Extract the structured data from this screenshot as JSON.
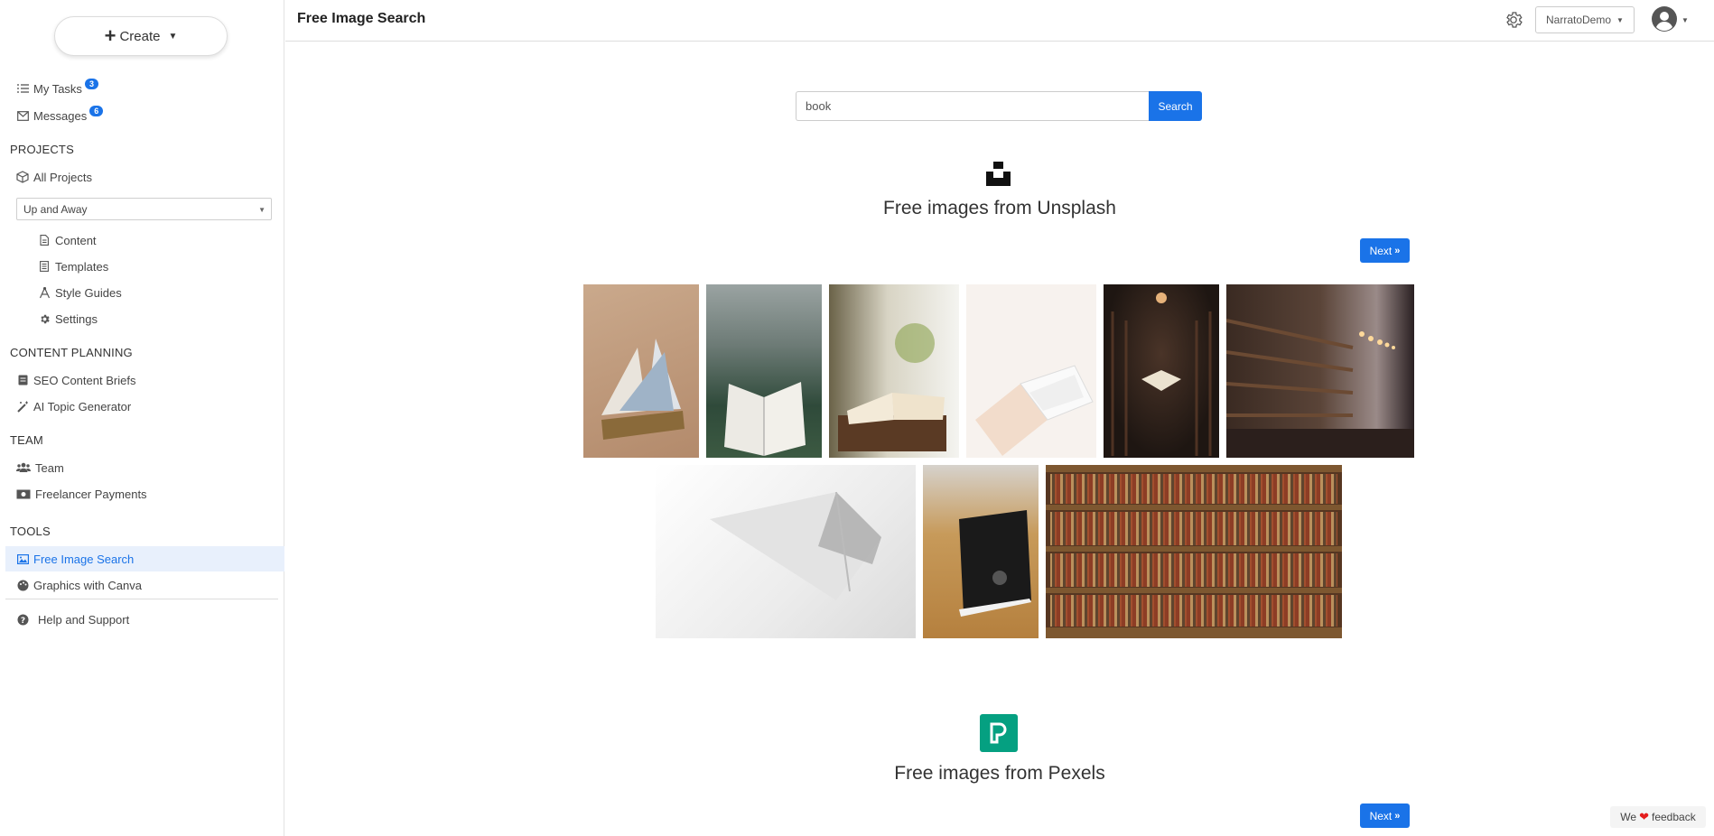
{
  "sidebar": {
    "create_label": "Create",
    "my_tasks": {
      "label": "My Tasks",
      "count": "3"
    },
    "messages": {
      "label": "Messages",
      "count": "6"
    },
    "projects_heading": "PROJECTS",
    "all_projects": "All Projects",
    "project_selected": "Up and Away",
    "project_links": [
      "Content",
      "Templates",
      "Style Guides",
      "Settings"
    ],
    "content_planning_heading": "CONTENT PLANNING",
    "content_planning_items": [
      "SEO Content Briefs",
      "AI Topic Generator"
    ],
    "team_heading": "TEAM",
    "team_items": [
      "Team",
      "Freelancer Payments"
    ],
    "tools_heading": "TOOLS",
    "tools_items": [
      "Free Image Search",
      "Graphics with Canva"
    ],
    "help": "Help and Support"
  },
  "header": {
    "title": "Free Image Search",
    "user": "NarratoDemo"
  },
  "search": {
    "value": "book",
    "button": "Search"
  },
  "unsplash": {
    "title": "Free images from Unsplash",
    "next_label": "Next"
  },
  "pexels": {
    "title": "Free images from Pexels",
    "next_label": "Next"
  },
  "feedback": {
    "before": "We",
    "after": "feedback"
  },
  "colors": {
    "primary": "#1a73e8",
    "pexels_green": "#05a081",
    "active_bg": "#e8f0fc"
  }
}
